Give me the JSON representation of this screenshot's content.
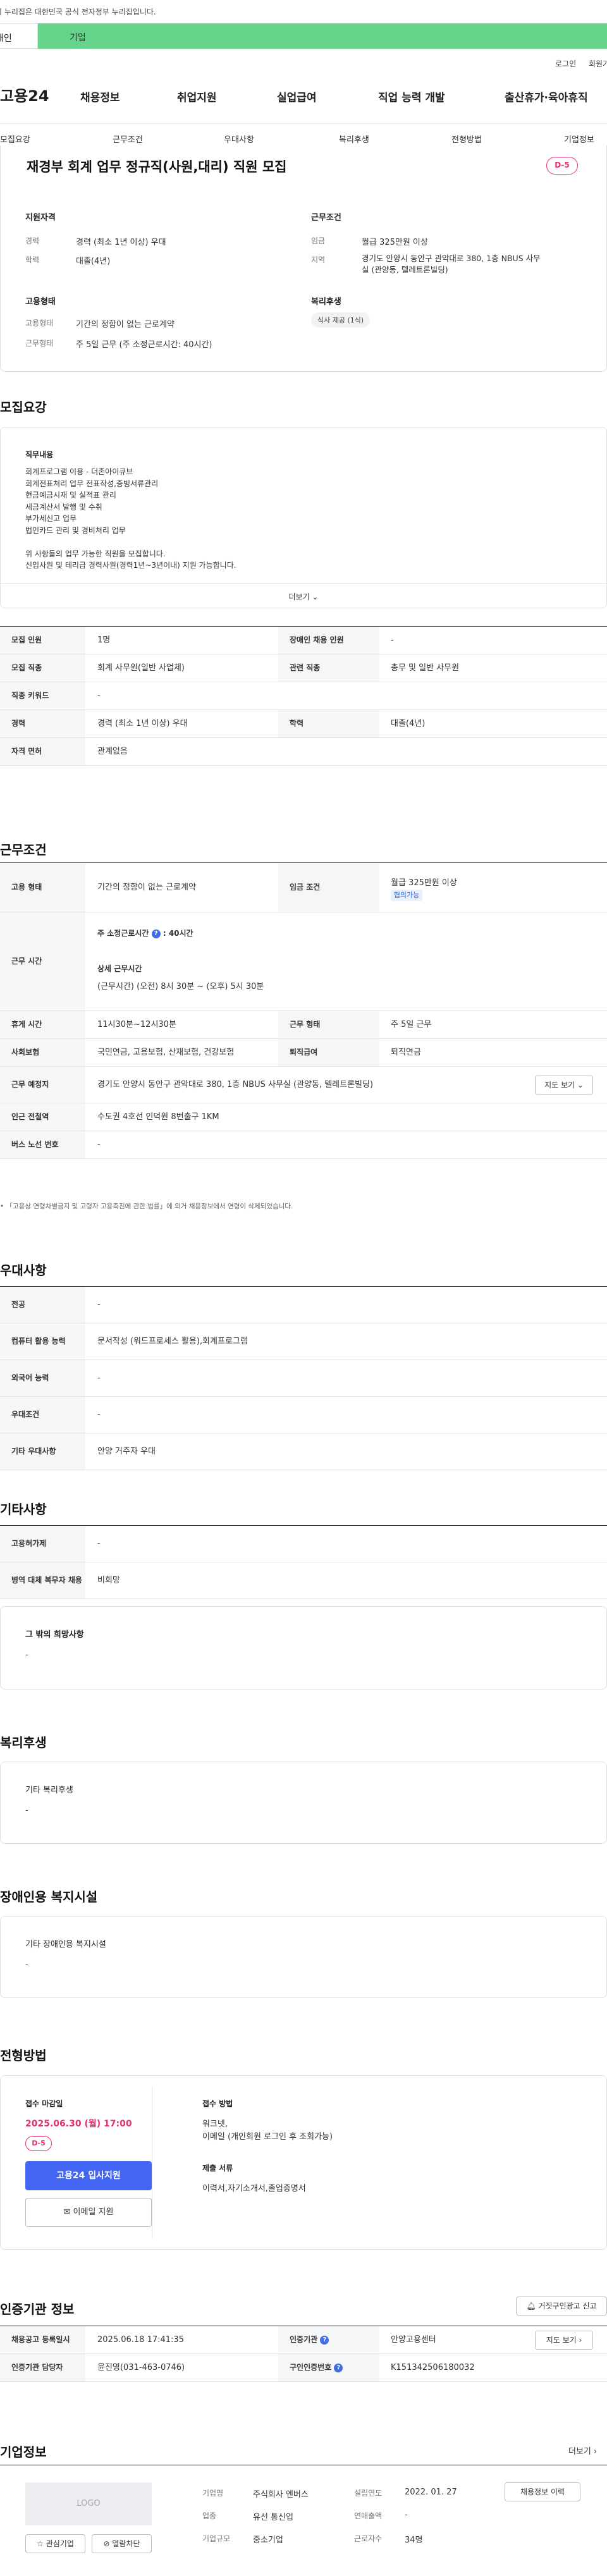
{
  "gov_banner": "이 누리집은 대한민국 공식 전자정부 누리집입니다.",
  "top_tabs": [
    "개인",
    "기업"
  ],
  "util_links": [
    "로그인",
    "회원가입"
  ],
  "logo": "고용24",
  "gnb": [
    "채용정보",
    "취업지원",
    "실업급여",
    "직업 능력 개발",
    "출산휴가·육아휴직"
  ],
  "subnav": [
    "모집요강",
    "근무조건",
    "우대사항",
    "복리후생",
    "전형방법",
    "기업정보"
  ],
  "job": {
    "title": "재경부 회계 업무 정규직(사원,대리) 직원 모집",
    "dday": "D-5",
    "qual_label": "지원자격",
    "career_k": "경력",
    "career_v": "경력 (최소 1년 이상) 우대",
    "edu_k": "학력",
    "edu_v": "대졸(4년)",
    "emp_label": "고용형태",
    "emptype_k": "고용형태",
    "emptype_v": "기간의 정함이 없는 근로계약",
    "worktype_k": "근무형태",
    "worktype_v": "주 5일 근무 (주 소정근로시간: 40시간)",
    "cond_label": "근무조건",
    "wage_k": "임금",
    "wage_v": "월급 325만원 이상",
    "region_k": "지역",
    "region_v1": "경기도 안양시 동안구 관악대로 380, 1층 NBUS 사무",
    "region_v2": "실 (관양동, 텔레트론빌딩)",
    "welfare_label": "복리후생",
    "welfare_tag": "식사 제공 (1식)"
  },
  "recruit": {
    "section_title": "모집요강",
    "duty_label": "직무내용",
    "duties": [
      "회계프로그램 이용 - 더존아이큐브",
      "회계전표처리 업무 전표작성,증빙서류관리",
      "현금예금시재 및 실적표 관리",
      "세금계산서 발행 및 수취",
      "부가세신고 업무",
      "법인카드 관리 및 경비처리 업무",
      "",
      "위 사항들의 업무 가능한 직원을 모집합니다.",
      "신입사원 및 테리급 경력사원(경력1년~3년이내) 지원 가능합니다."
    ],
    "more": "더보기",
    "rows": [
      {
        "k1": "모집 인원",
        "v1": "1명",
        "k2": "장애인 채용 인원",
        "v2": "-"
      },
      {
        "k1": "모집 직종",
        "v1": "회계 사무원(일반 사업체)",
        "k2": "관련 직종",
        "v2": "총무 및 일반 사무원"
      },
      {
        "k1": "직종 키워드",
        "v1": "-"
      },
      {
        "k1": "경력",
        "v1": "경력 (최소 1년 이상) 우대",
        "k2": "학력",
        "v2": "대졸(4년)"
      },
      {
        "k1": "자격 면허",
        "v1": "관계없음"
      }
    ]
  },
  "work": {
    "section_title": "근무조건",
    "emptype_k": "고용 형태",
    "emptype_v": "기간의 정함이 없는 근로계약",
    "wage_k": "임금 조건",
    "wage_v": "월급 325만원 이상",
    "wage_pill": "협의가능",
    "hours_k": "근무 시간",
    "hours_title": "주 소정근로시간",
    "hours_val": "40시간",
    "hours_detail_title": "상세 근무시간",
    "hours_detail": "(근무시간) (오전) 8시 30분 ~ (오후) 5시 30분",
    "break_k": "휴게 시간",
    "break_v": "11시30분~12시30분",
    "worktype_k": "근무 형태",
    "worktype_v": "주 5일 근무",
    "ins_k": "사회보험",
    "ins_v": "국민연금, 고용보험, 산재보험, 건강보험",
    "ret_k": "퇴직급여",
    "ret_v": "퇴직연금",
    "loc_k": "근무 예정지",
    "loc_v": "경기도 안양시 동안구 관악대로 380, 1층 NBUS 사무실 (관양동, 텔레트론빌딩)",
    "map_btn": "지도 보기",
    "station_k": "인근 전철역",
    "station_v": "수도권 4호선 인덕원 8번출구 1KM",
    "bus_k": "버스 노선 번호",
    "bus_v": "-",
    "note": "「고용상 연령차별금지 및 고령자 고용촉진에 관한 법률」에 의거 채용정보에서 연령이 삭제되었습니다."
  },
  "pref": {
    "section_title": "우대사항",
    "rows": [
      {
        "k": "전공",
        "v": "-"
      },
      {
        "k": "컴퓨터 활용 능력",
        "v": "문서작성 (워드프로세스 활용),회계프로그램"
      },
      {
        "k": "외국어 능력",
        "v": "-"
      },
      {
        "k": "우대조건",
        "v": "-"
      },
      {
        "k": "기타 우대사항",
        "v": "안양 거주자 우대"
      }
    ]
  },
  "etc": {
    "section_title": "기타사항",
    "rows": [
      {
        "k": "고용허가제",
        "v": "-"
      },
      {
        "k": "병역 대체 복무자 채용",
        "v": "비희망"
      }
    ],
    "hope_label": "그 밖의 희망사항",
    "hope_v": "-"
  },
  "welfare": {
    "section_title": "복리후생",
    "label": "기타 복리후생",
    "v": "-"
  },
  "disabled": {
    "section_title": "장애인용 복지시설",
    "label": "기타 장애인용 복지시설",
    "v": "-"
  },
  "process": {
    "section_title": "전형방법",
    "deadline_label": "접수 마감일",
    "deadline": "2025.06.30 (월) 17:00",
    "dday": "D-5",
    "apply_btn": "고용24 입사지원",
    "email_btn": "이메일 지원",
    "method_label": "접수 방법",
    "method_v1": "워크넷,",
    "method_v2": "이메일 (개인회원 로그인 후 조회가능)",
    "docs_label": "제출 서류",
    "docs_v": "이력서,자기소개서,졸업증명서"
  },
  "agency": {
    "section_title": "인증기관 정보",
    "report_btn": "거짓구인광고 신고",
    "reg_k": "채용공고 등록일시",
    "reg_v": "2025.06.18 17:41:35",
    "org_k": "인증기관",
    "org_v": "안양고용센터",
    "map_btn": "지도 보기",
    "mgr_k": "인증기관 담당자",
    "mgr_v": "윤진영(031-463-0746)",
    "cert_k": "구인인증번호",
    "cert_v": "K151342506180032"
  },
  "company": {
    "section_title": "기업정보",
    "more": "더보기",
    "logo_text": "LOGO",
    "fav_btn": "관심기업",
    "block_btn": "열람차단",
    "name_k": "기업명",
    "name_v": "주식회사 엔버스",
    "founded_k": "설립연도",
    "founded_v": "2022. 01. 27",
    "jobs_btn": "채용정보 이력",
    "ind_k": "업종",
    "ind_v": "유선 통신업",
    "sales_k": "연매출액",
    "sales_v": "-",
    "size_k": "기업규모",
    "size_v": "중소기업",
    "emp_k": "근로자수",
    "emp_v": "34명"
  }
}
